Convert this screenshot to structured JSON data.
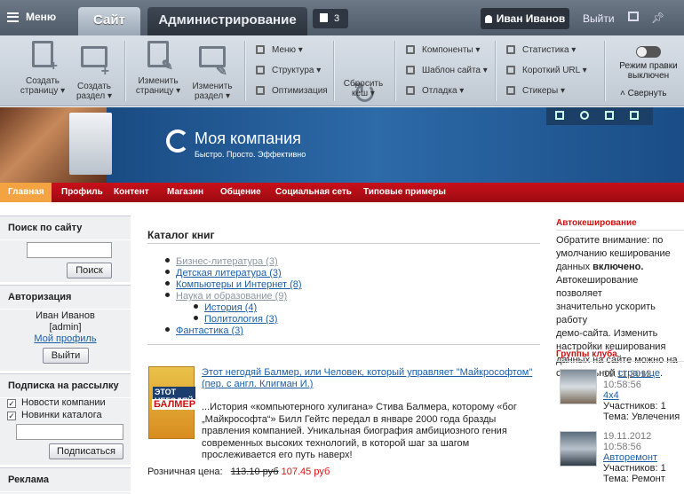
{
  "topbar": {
    "menu_label": "Меню",
    "tab_site": "Сайт",
    "tab_admin": "Администрирование",
    "notifications_count": "3",
    "user_name": "Иван Иванов",
    "logout_label": "Выйти"
  },
  "toolbar": {
    "create_page": [
      "Создать",
      "страницу"
    ],
    "create_section": [
      "Создать",
      "раздел"
    ],
    "edit_page": [
      "Изменить",
      "страницу"
    ],
    "edit_section": [
      "Изменить",
      "раздел"
    ],
    "menu": "Меню",
    "structure": "Структура",
    "optimization": "Оптимизация",
    "reset_cache": [
      "Сбросить",
      "кеш"
    ],
    "components": "Компоненты",
    "site_template": "Шаблон сайта",
    "debug": "Отладка",
    "statistics": "Статистика",
    "short_url": "Короткий URL",
    "stickers": "Стикеры",
    "edit_mode": [
      "Режим правки",
      "выключен"
    ],
    "collapse": "Свернуть"
  },
  "banner": {
    "company_name": "Моя компания",
    "slogan": "Быстро. Просто. Эффективно"
  },
  "nav": [
    "Главная",
    "Профиль",
    "Контент",
    "Магазин",
    "Общение",
    "Социальная сеть",
    "Типовые примеры"
  ],
  "left": {
    "search_title": "Поиск по сайту",
    "search_button": "Поиск",
    "auth_title": "Авторизация",
    "auth_name": "Иван Иванов",
    "auth_login": "[admin]",
    "profile_link": "Мой профиль",
    "logout_button": "Выйти",
    "subscribe_title": "Подписка на рассылку",
    "sub_news": "Новости компании",
    "sub_catalog": "Новинки каталога",
    "subscribe_button": "Подписаться",
    "ads_title": "Реклама"
  },
  "content": {
    "title": "Каталог книг",
    "categories": [
      {
        "label": "Бизнес-литература (3)",
        "style": "grey"
      },
      {
        "label": "Детская литература (3)",
        "style": "link"
      },
      {
        "label": "Компьютеры и Интернет (8)",
        "style": "link"
      },
      {
        "label": "Наука и образование (9)",
        "style": "grey"
      },
      {
        "label": "История (4)",
        "style": "link"
      },
      {
        "label": "Политология (3)",
        "style": "link"
      },
      {
        "label": "Фантастика (3)",
        "style": "link"
      }
    ],
    "book_title_1": "Этот негодяй Балмер, или Человек, который управляет \"Майкрософтом\"",
    "book_title_2": "(пер. с англ. Клигман И.)",
    "cover_line1": "ЭТОТ НЕГОДЯЙ",
    "cover_line2": "БАЛМЕР",
    "desc_lines": [
      "...История «компьютерного хулигана» Стива Балмера, которому «бог",
      "„Майкрософта“» Билл Гейтс передал в январе 2000 года бразды",
      "правления компанией. Уникальная биография амбициозного гения",
      "современных высоких технологий, в которой шаг за шагом",
      "прослеживается его путь наверх!"
    ],
    "price_label": "Розничная цена:",
    "old_price": "113.10 руб",
    "new_price": "107.45 руб"
  },
  "right": {
    "autocache_title": "Автокеширование",
    "autocache_lines": [
      "Обратите внимание: по",
      "умолчанию кеширование",
      "данных ",
      "Автокеширование позволяет",
      "значительно ускорить работу",
      "демо-сайта. Изменить",
      "настройки кеширования",
      "данных на сайте можно на",
      "специальной "
    ],
    "autocache_bold": "включено.",
    "autocache_link": "странице",
    "groups_title": "Группы клуба",
    "groups": [
      {
        "date": "19.11.2012",
        "time": "10:58:56",
        "name": "4x4",
        "members": "Участников: 1",
        "topic": "Тема: Увлечения"
      },
      {
        "date": "19.11.2012",
        "time": "10:58:56",
        "name": "Авторемонт",
        "members": "Участников: 1",
        "topic": "Тема: Ремонт"
      }
    ]
  }
}
